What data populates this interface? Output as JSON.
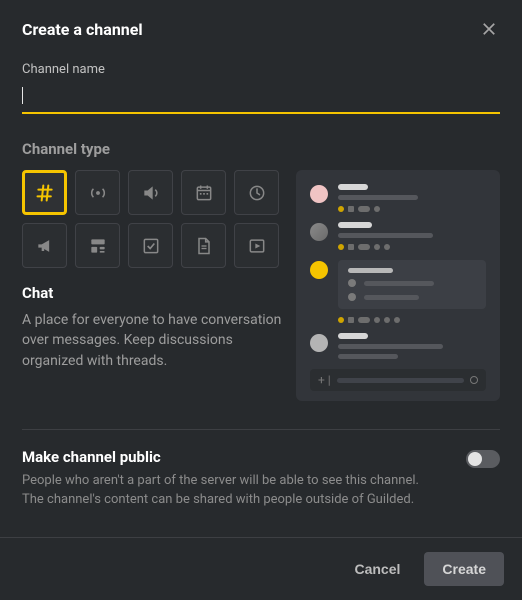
{
  "header": {
    "title": "Create a channel"
  },
  "name_field": {
    "label": "Channel name",
    "value": ""
  },
  "type_section": {
    "label": "Channel type",
    "selected_name": "Chat",
    "selected_desc": "A place for everyone to have conversation over messages. Keep discussions organized with threads.",
    "types": [
      {
        "id": "chat",
        "icon": "hash-icon",
        "selected": true
      },
      {
        "id": "voice",
        "icon": "broadcast-icon",
        "selected": false
      },
      {
        "id": "stream",
        "icon": "volume-icon",
        "selected": false
      },
      {
        "id": "calendar",
        "icon": "calendar-icon",
        "selected": false
      },
      {
        "id": "scheduling",
        "icon": "clock-icon",
        "selected": false
      },
      {
        "id": "announcements",
        "icon": "megaphone-icon",
        "selected": false
      },
      {
        "id": "forums",
        "icon": "layout-icon",
        "selected": false
      },
      {
        "id": "list",
        "icon": "checkbox-icon",
        "selected": false
      },
      {
        "id": "docs",
        "icon": "document-icon",
        "selected": false
      },
      {
        "id": "media",
        "icon": "play-icon",
        "selected": false
      }
    ]
  },
  "public": {
    "title": "Make channel public",
    "desc": "People who aren't a part of the server will be able to see this channel. The channel's content can be shared with people outside of Guilded.",
    "enabled": false
  },
  "footer": {
    "cancel": "Cancel",
    "create": "Create"
  },
  "colors": {
    "accent": "#f5c400"
  }
}
